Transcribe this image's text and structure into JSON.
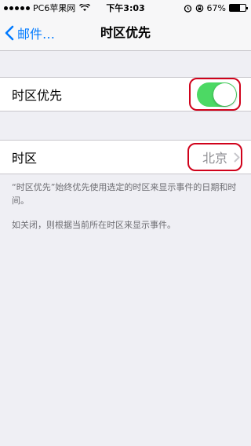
{
  "status_bar": {
    "carrier": "PC6苹果网",
    "time": "下午3:03",
    "battery": "67%",
    "battery_level": 0.67,
    "icons": [
      "signal-dots-icon",
      "wifi-icon",
      "alarm-icon",
      "rotation-lock-icon",
      "battery-icon"
    ]
  },
  "nav": {
    "back_label": "邮件…",
    "title": "时区优先"
  },
  "settings": {
    "timezone_override": {
      "label": "时区优先",
      "enabled": true
    },
    "timezone": {
      "label": "时区",
      "value": "北京"
    }
  },
  "footer": {
    "description": "“时区优先”始终优先使用选定的时区来显示事件的日期和时间。",
    "note": "如关闭，则根据当前所在时区来显示事件。"
  },
  "colors": {
    "accent": "#007aff",
    "toggle_on": "#4cd964",
    "highlight": "#d0021b",
    "background": "#efeff4"
  }
}
